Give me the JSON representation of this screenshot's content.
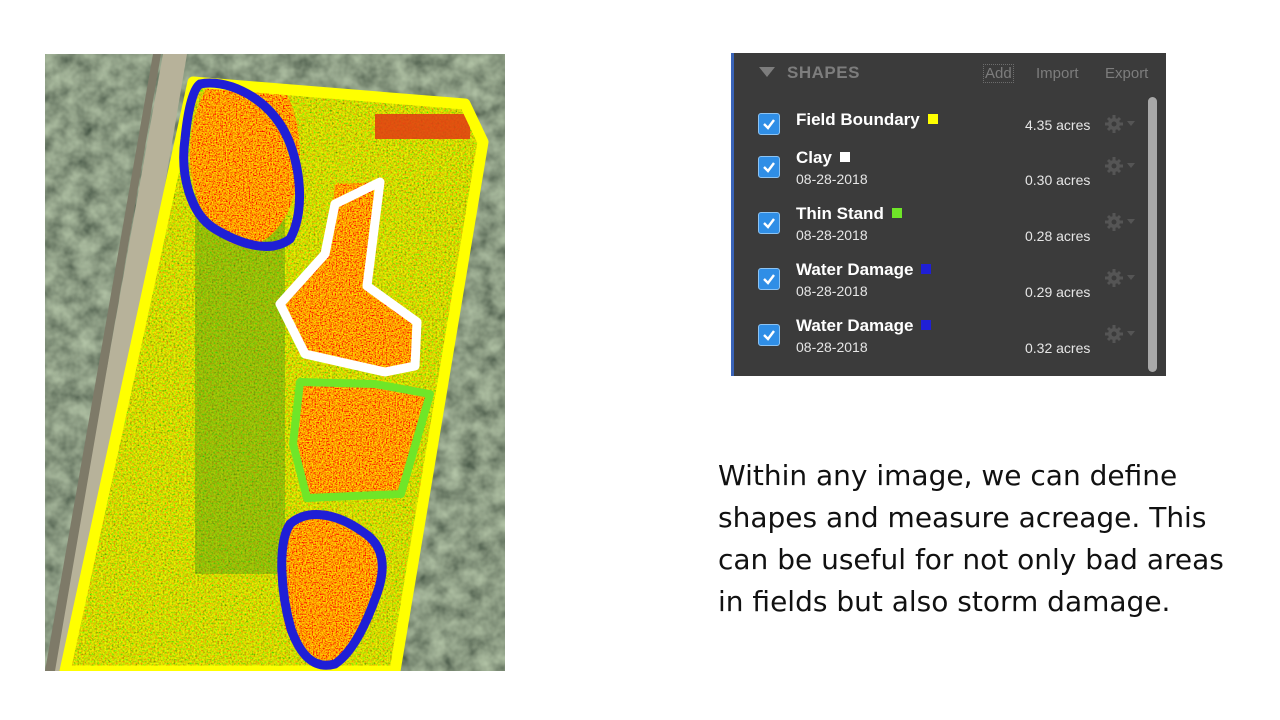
{
  "colors": {
    "field_boundary": "#ffff00",
    "clay": "#ffffff",
    "thin_stand": "#6fe628",
    "water_damage": "#1f1fd6",
    "panel_bg": "#3b3b3b",
    "checkbox": "#2f8ee6",
    "panel_accent": "#3a64b8"
  },
  "shapes_panel": {
    "title": "SHAPES",
    "add_label": "Add",
    "import_label": "Import",
    "export_label": "Export",
    "rows": [
      {
        "name": "Field Boundary",
        "date": "",
        "acres": "4.35 acres",
        "swatch": "#ffff00",
        "checked": true
      },
      {
        "name": "Clay",
        "date": "08-28-2018",
        "acres": "0.30 acres",
        "swatch": "#ffffff",
        "checked": true
      },
      {
        "name": "Thin Stand",
        "date": "08-28-2018",
        "acres": "0.28 acres",
        "swatch": "#6fe628",
        "checked": true
      },
      {
        "name": "Water Damage",
        "date": "08-28-2018",
        "acres": "0.29 acres",
        "swatch": "#1f1fd6",
        "checked": true
      },
      {
        "name": "Water Damage",
        "date": "08-28-2018",
        "acres": "0.32 acres",
        "swatch": "#1f1fd6",
        "checked": true
      }
    ]
  },
  "description": "Within any image, we can define shapes and measure acreage. This can be useful for not only bad areas in fields but also storm damage."
}
